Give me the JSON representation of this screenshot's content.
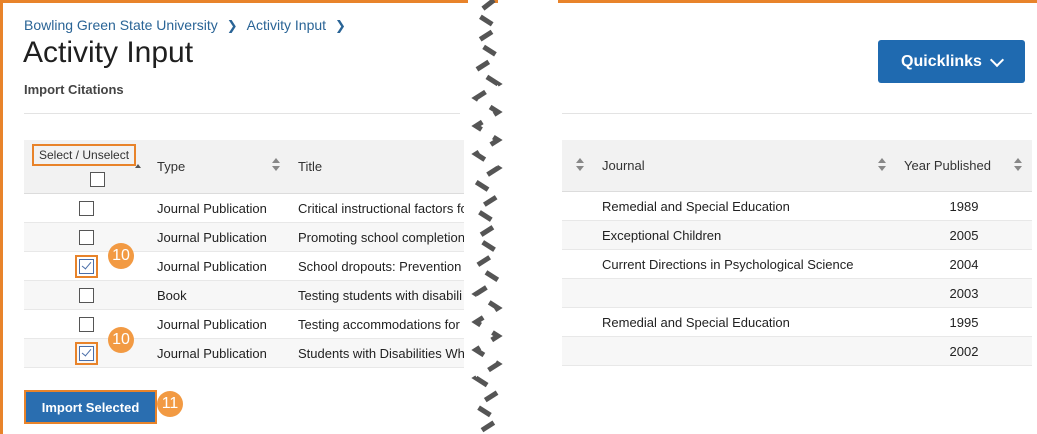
{
  "breadcrumb": {
    "root": "Bowling Green State University",
    "current": "Activity Input"
  },
  "page": {
    "title": "Activity Input",
    "subtitle": "Import Citations"
  },
  "quicklinks": {
    "label": "Quicklinks"
  },
  "table": {
    "headers": {
      "select": "Select / Unselect",
      "type": "Type",
      "title": "Title",
      "journal": "Journal",
      "year": "Year Published"
    },
    "rows": [
      {
        "type": "Journal Publication",
        "title": "Critical instructional factors fo",
        "journal": "Remedial and Special Education",
        "year": "1989",
        "checked": false
      },
      {
        "type": "Journal Publication",
        "title": "Promoting school completion",
        "journal": "Exceptional Children",
        "year": "2005",
        "checked": false
      },
      {
        "type": "Journal Publication",
        "title": "School dropouts: Prevention",
        "journal": "Current Directions in Psychological Science",
        "year": "2004",
        "checked": true
      },
      {
        "type": "Book",
        "title": "Testing students with disabili",
        "journal": "",
        "year": "2003",
        "checked": false
      },
      {
        "type": "Journal Publication",
        "title": "Testing accommodations for",
        "journal": "Remedial and Special Education",
        "year": "1995",
        "checked": false
      },
      {
        "type": "Journal Publication",
        "title": "Students with Disabilities Who",
        "journal": "",
        "year": "2002",
        "checked": true
      }
    ]
  },
  "callouts": {
    "row_badge": "10",
    "import_badge": "11"
  },
  "import": {
    "label": "Import Selected"
  },
  "colors": {
    "accent": "#e8832a",
    "primary": "#1f6ab0",
    "link": "#2a6496",
    "badge": "#f29a43"
  },
  "icons": {
    "sort": "sort-arrows-icon",
    "chevron": "chevron-down-icon",
    "check": "checkbox-icon"
  }
}
